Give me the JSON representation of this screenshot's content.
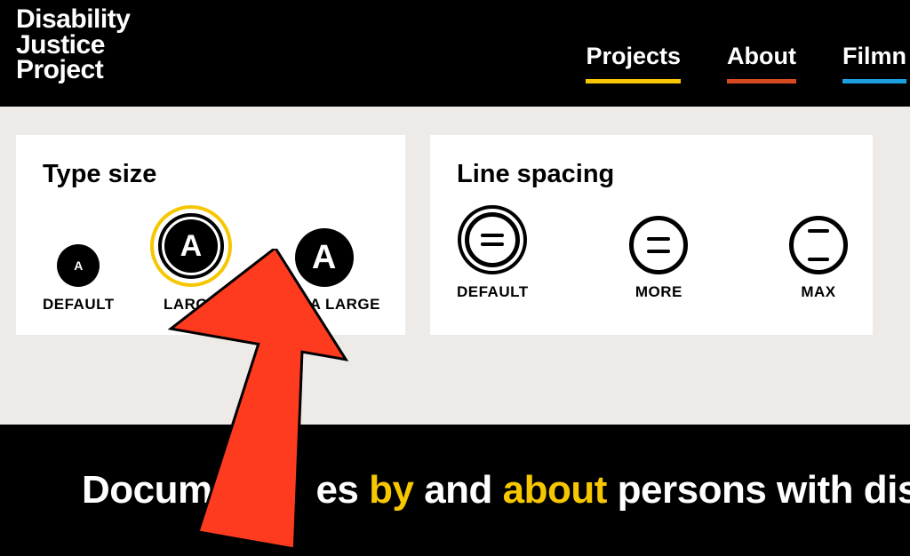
{
  "logo": {
    "line1": "Disability",
    "line2": "Justice",
    "line3": "Project"
  },
  "nav": {
    "projects": "Projects",
    "about": "About",
    "film": "Filmn"
  },
  "typesize": {
    "title": "Type size",
    "glyph": "A",
    "default": "DEFAULT",
    "large": "LARGE",
    "xlarge": "EXTRA LARGE"
  },
  "linespacing": {
    "title": "Line spacing",
    "default": "DEFAULT",
    "more": "MORE",
    "max": "MAX"
  },
  "tagline": {
    "p1": "Documenta",
    "gap": "es ",
    "by": "by",
    "p2": " and ",
    "about": "about",
    "p3": " persons with disa"
  },
  "colors": {
    "yellow": "#f6c700",
    "red": "#d64a1f",
    "blue": "#1c9fe0",
    "arrow": "#ff3b1f"
  }
}
